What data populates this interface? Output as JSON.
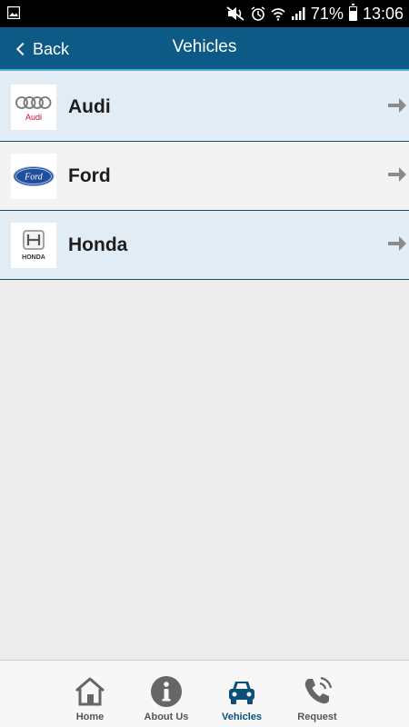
{
  "status_bar": {
    "battery_percent": "71%",
    "time": "13:06",
    "icons": [
      "image-icon",
      "mute-icon",
      "alarm-icon",
      "wifi-icon",
      "signal-icon",
      "battery-icon"
    ]
  },
  "header": {
    "back_label": "Back",
    "title": "Vehicles",
    "background": "#0c5a85"
  },
  "vehicles": [
    {
      "name": "Audi",
      "logo": "audi-logo",
      "logo_text": "Audi"
    },
    {
      "name": "Ford",
      "logo": "ford-logo",
      "logo_text": "Ford"
    },
    {
      "name": "Honda",
      "logo": "honda-logo",
      "logo_text": "HONDA"
    }
  ],
  "tabs": [
    {
      "label": "Home",
      "icon": "home-icon",
      "active": false
    },
    {
      "label": "About Us",
      "icon": "info-icon",
      "active": false
    },
    {
      "label": "Vehicles",
      "icon": "car-icon",
      "active": true
    },
    {
      "label": "Request",
      "icon": "phone-icon",
      "active": false
    }
  ],
  "colors": {
    "accent": "#0c4f7a",
    "row_alt": "#e2ecf4",
    "inactive_icon": "#666666"
  }
}
